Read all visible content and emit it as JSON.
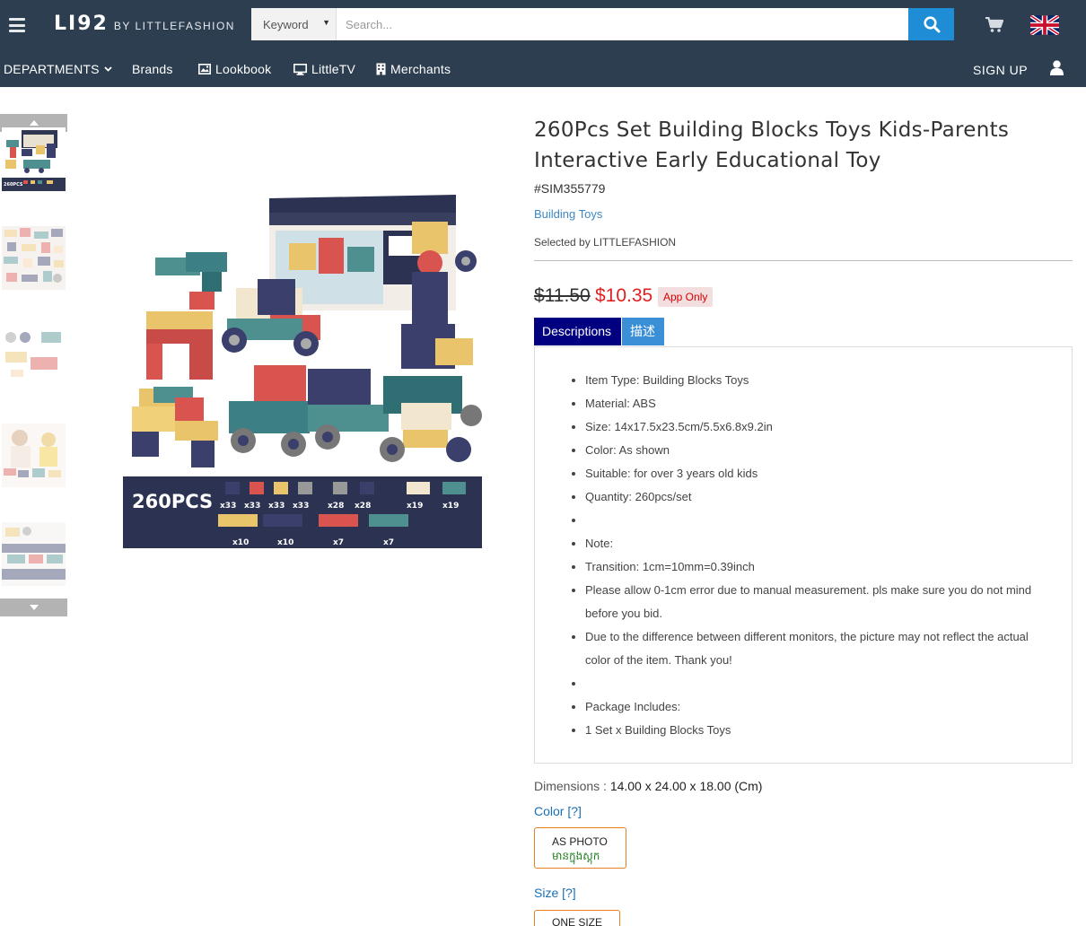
{
  "header": {
    "logo_main": "LI92",
    "logo_sub": "BY LITTLEFASHION",
    "search": {
      "keyword_select": "Keyword",
      "placeholder": "Search..."
    }
  },
  "nav": {
    "departments": "DEPARTMENTS",
    "brands": "Brands",
    "lookbook": "Lookbook",
    "littletv": "LittleTV",
    "merchants": "Merchants",
    "signup": "SIGN UP"
  },
  "product": {
    "title": "260Pcs Set Building Blocks Toys Kids-Parents Interactive Early Educational Toy",
    "sku": "#SIM355779",
    "category": "Building Toys",
    "selected_by": "Selected by LITTLEFASHION",
    "price_old": "$11.50",
    "price_new": "$10.35",
    "app_only": "App Only",
    "tabs": [
      "Descriptions",
      "描述"
    ],
    "description": [
      "Item Type: Building Blocks Toys",
      "Material: ABS",
      "Size: 14x17.5x23.5cm/5.5x6.8x9.2in",
      "Color: As shown",
      "Suitable: for over 3 years old kids",
      "Quantity: 260pcs/set",
      "",
      "Note:",
      "Transition: 1cm=10mm=0.39inch",
      "Please allow 0-1cm error due to manual measurement. pls make sure you do not mind before you bid.",
      "Due to the difference between different monitors, the picture may not reflect the actual color of the item. Thank you!",
      "",
      "Package Includes:",
      "1 Set x Building Blocks Toys"
    ],
    "dimensions_label": "Dimensions :",
    "dimensions_value": "14.00 x 24.00 x 18.00 (Cm)",
    "color_label": "Color [?]",
    "color_option": "AS PHOTO",
    "color_option_stock": "មានក្នុងស្តុក",
    "size_label": "Size [?]",
    "size_option": "ONE SIZE"
  },
  "image": {
    "banner_text": "260PCS",
    "counts_row1": [
      "x33",
      "x33",
      "x33",
      "x33",
      "x28",
      "x28",
      "x19",
      "x19"
    ],
    "counts_row2": [
      "x10",
      "x10",
      "x7",
      "x7"
    ]
  },
  "colors": {
    "header_bg": "#2c3e50",
    "search_btn": "#1f8dd6",
    "price_red": "#e02020",
    "tab_active": "#000080",
    "tab_inactive": "#3b8fd6",
    "link_blue": "#3f88c5",
    "option_border": "#e67e22"
  },
  "icons": [
    "menu-icon",
    "search-icon",
    "cart-icon",
    "uk-flag-icon",
    "chevron-down-icon",
    "lookbook-icon",
    "tv-icon",
    "merchants-icon",
    "user-icon",
    "arrow-up-icon",
    "arrow-down-icon"
  ]
}
